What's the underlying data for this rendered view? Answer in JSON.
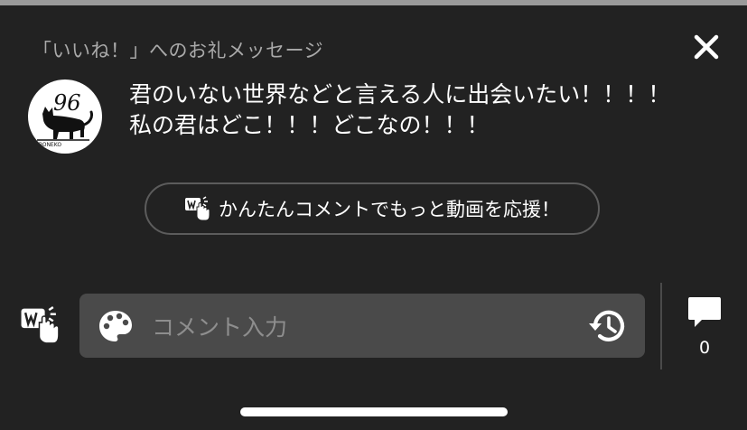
{
  "panel": {
    "title": "「いいね！」へのお礼メッセージ"
  },
  "avatar": {
    "number": "96",
    "caption": "KIBONEKO"
  },
  "message": {
    "line1": "君のいない世界などと言える人に出会いたい！！！！",
    "line2": "私の君はどこ！！！どこなの！！！"
  },
  "easy_comment_button": {
    "label": "かんたんコメントでもっと動画を応援！"
  },
  "comment_input": {
    "placeholder": "コメント入力"
  },
  "comments": {
    "count": "0"
  },
  "colors": {
    "background": "#222222",
    "input_background": "#4a4a4a",
    "title_gray": "#a9a9a9",
    "pill_border": "#5c5c5c"
  },
  "icons": {
    "close": "close-icon",
    "easy_comment": "easy-comment-icon",
    "palette": "palette-icon",
    "history": "history-icon",
    "comment": "comment-bubble-icon"
  }
}
